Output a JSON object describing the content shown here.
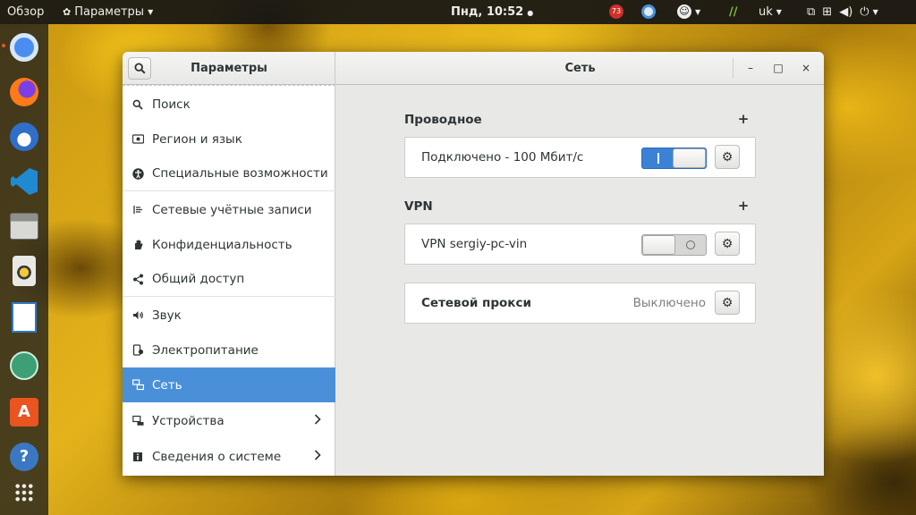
{
  "topbar": {
    "activities": "Обзор",
    "app_menu": "Параметры",
    "clock": "Пнд, 10:52",
    "badge_count": "73",
    "keyboard_layout": "uk"
  },
  "dock": {
    "items": [
      "chromium",
      "firefox",
      "thunderbird",
      "vscode",
      "files",
      "rhythmbox",
      "libreoffice-writer",
      "atom",
      "software-center",
      "help",
      "show-applications"
    ]
  },
  "window": {
    "sidebar_title": "Параметры",
    "main_title": "Сеть",
    "controls": {
      "minimize": "–",
      "maximize": "□",
      "close": "×"
    }
  },
  "sidebar": {
    "items": [
      {
        "label": "Поиск",
        "icon": "search-icon"
      },
      {
        "label": "Регион и язык",
        "icon": "region-icon"
      },
      {
        "label": "Специальные возможности",
        "icon": "accessibility-icon"
      },
      {
        "label": "Сетевые учётные записи",
        "icon": "online-accounts-icon"
      },
      {
        "label": "Конфиденциальность",
        "icon": "privacy-hand-icon"
      },
      {
        "label": "Общий доступ",
        "icon": "share-icon"
      },
      {
        "label": "Звук",
        "icon": "speaker-icon"
      },
      {
        "label": "Электропитание",
        "icon": "power-icon"
      },
      {
        "label": "Сеть",
        "icon": "network-icon",
        "active": true
      },
      {
        "label": "Устройства",
        "icon": "devices-icon",
        "chevron": ">"
      },
      {
        "label": "Сведения о системе",
        "icon": "info-icon",
        "chevron": ">"
      }
    ]
  },
  "network": {
    "wired": {
      "title": "Проводное",
      "add": "+",
      "status": "Подключено - 100 Мбит/с",
      "enabled": true
    },
    "vpn": {
      "title": "VPN",
      "add": "+",
      "name": "VPN sergiy-pc-vin",
      "enabled": false
    },
    "proxy": {
      "title": "Сетевой прокси",
      "status": "Выключено"
    }
  },
  "colors": {
    "accent": "#4a90d9",
    "switch_on": "#3b82d6",
    "topbar": "#141414",
    "ubuntu_orange": "#e95420"
  }
}
